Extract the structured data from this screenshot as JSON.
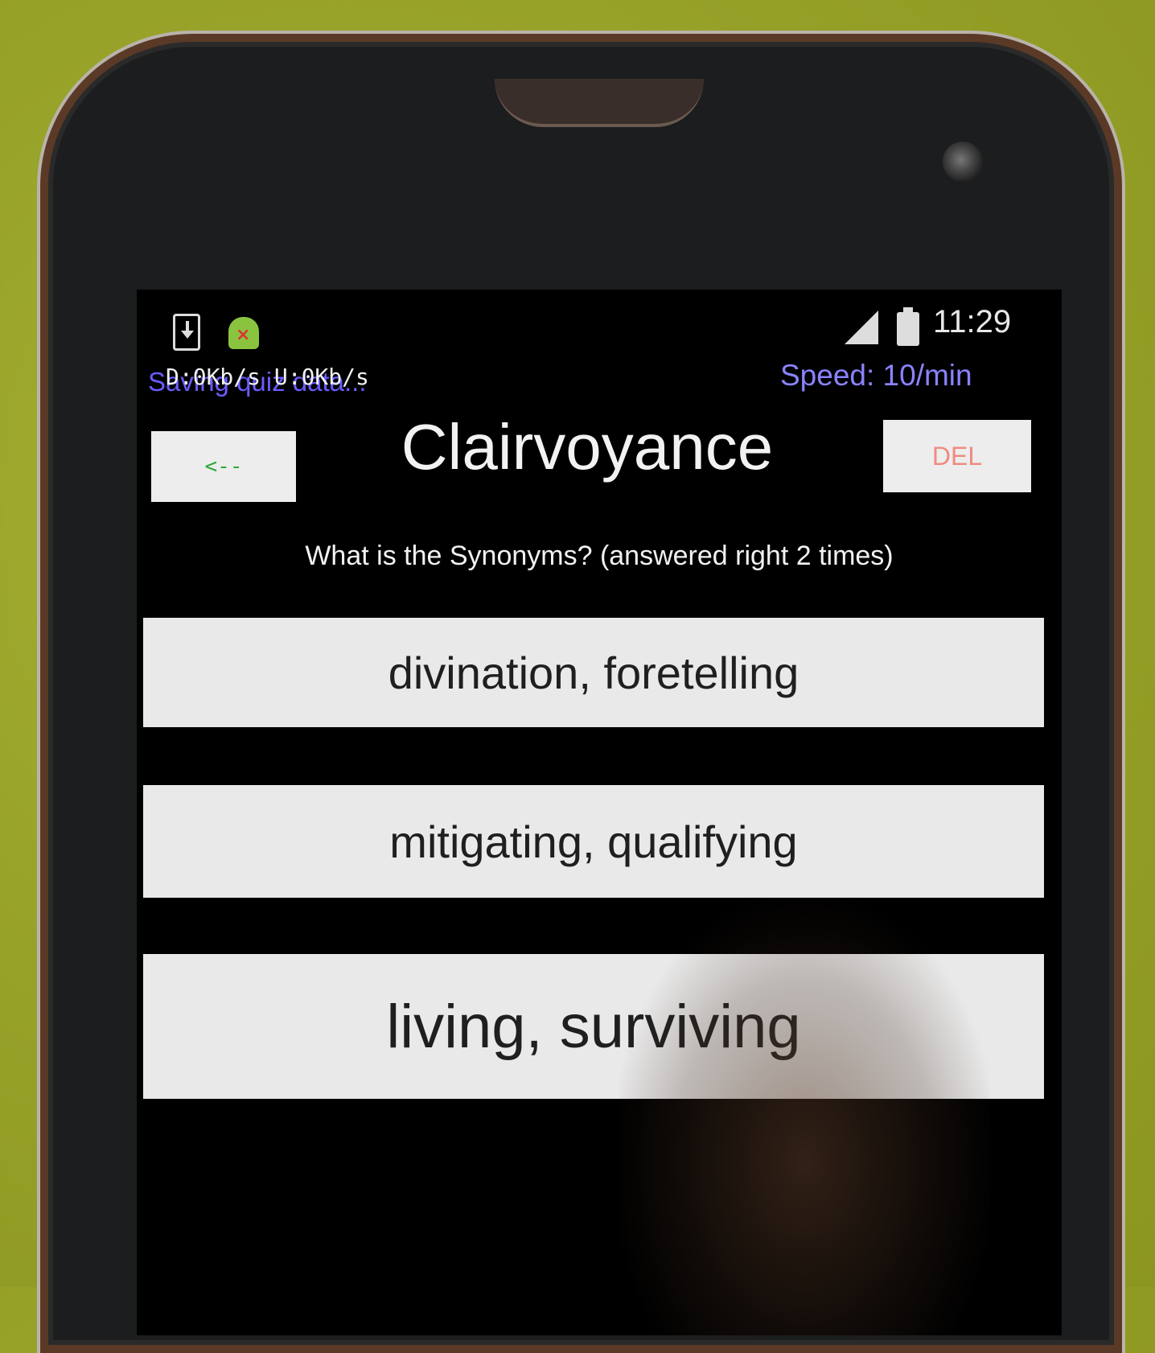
{
  "status_bar": {
    "time": "11:29",
    "icons": [
      "download-icon",
      "android-icon",
      "signal-icon",
      "battery-icon"
    ]
  },
  "overlay": {
    "saving_text": "Saving quiz data...",
    "network_text": "D:0Kb/s   U:0Kb/s",
    "speed_text": "Speed: 10/min"
  },
  "header": {
    "back_label": "<--",
    "word": "Clairvoyance",
    "delete_label": "DEL"
  },
  "question": "What is the Synonyms? (answered right 2 times)",
  "answers": [
    "divination, foretelling",
    "mitigating, qualifying",
    "living, surviving"
  ],
  "colors": {
    "background": "#000000",
    "button": "#e9e9e9",
    "back_text": "#2ea83a",
    "delete_text": "#ef8b80",
    "overlay_text": "#6a5cff"
  }
}
